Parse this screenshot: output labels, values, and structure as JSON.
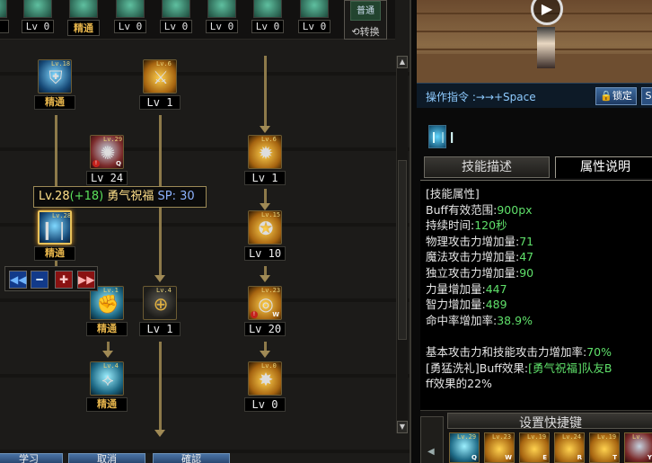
{
  "top_skills": [
    {
      "level": "0",
      "masterized": false
    },
    {
      "level": "Lv 0",
      "masterized": false
    },
    {
      "level": "精通",
      "masterized": true
    },
    {
      "level": "Lv 0",
      "masterized": false
    },
    {
      "level": "Lv 0",
      "masterized": false
    },
    {
      "level": "Lv 0",
      "masterized": false
    },
    {
      "level": "Lv 0",
      "masterized": false
    },
    {
      "level": "Lv 0",
      "masterized": false
    }
  ],
  "swap": {
    "icon_label": "普通",
    "label": "⟲转换"
  },
  "tree_nodes": [
    {
      "tag": "Lv.18",
      "level": "精通",
      "masterized": true,
      "icon": "shield-icon"
    },
    {
      "tag": "Lv.6",
      "level": "Lv 1",
      "masterized": false,
      "icon": "sword-icon"
    },
    {
      "tag": "Lv.29",
      "level": "Lv 24",
      "masterized": false,
      "icon": "swirl-icon"
    },
    {
      "tag": "Lv.6",
      "level": "Lv 1",
      "masterized": false,
      "icon": "flame-icon"
    },
    {
      "tag": "Lv.28",
      "level": "精通",
      "masterized": true,
      "icon": "blessing-icon"
    },
    {
      "tag": "Lv.15",
      "level": "Lv 10",
      "masterized": false,
      "icon": "lion-icon"
    },
    {
      "tag": "Lv.1",
      "level": "精通",
      "masterized": true,
      "icon": "fist-icon"
    },
    {
      "tag": "Lv.4",
      "level": "Lv 1",
      "masterized": false,
      "icon": "target-icon"
    },
    {
      "tag": "Lv.23",
      "level": "Lv 20",
      "masterized": false,
      "icon": "ring-icon"
    },
    {
      "tag": "Lv.4",
      "level": "精通",
      "masterized": true,
      "icon": "wings-icon"
    },
    {
      "tag": "Lv.0",
      "level": "Lv 0",
      "masterized": false,
      "icon": "burst-icon"
    }
  ],
  "tooltip": {
    "level": "Lv.28",
    "bonus": "(+18)",
    "name": "勇气祝福",
    "sp_label": "SP",
    "sp_sep": ":",
    "sp_value": "30"
  },
  "controls": {
    "first": "◀◀",
    "minus": "━",
    "plus": "✚",
    "last": "▶▶"
  },
  "bottom_buttons": [
    "学习",
    "取消",
    "確認"
  ],
  "command": {
    "label": "操作指令",
    "sep": ":",
    "keys": "→→+Space"
  },
  "lock_button": "🔒锁定",
  "small_button": "S",
  "tabs": {
    "description": "技能描述",
    "attributes": "属性说明"
  },
  "attributes": {
    "header": "[技能属性]",
    "rows": [
      {
        "label": "Buff有效范围",
        "sep": ":",
        "value": "900px"
      },
      {
        "label": "持续时间",
        "sep": ":",
        "value": "120秒"
      },
      {
        "label": "物理攻击力增加量",
        "sep": ":",
        "value": "71"
      },
      {
        "label": "魔法攻击力增加量",
        "sep": ":",
        "value": "47"
      },
      {
        "label": "独立攻击力增加量",
        "sep": ":",
        "value": "90"
      },
      {
        "label": "力量增加量",
        "sep": ":",
        "value": "447"
      },
      {
        "label": "智力增加量",
        "sep": ":",
        "value": "489"
      },
      {
        "label": "命中率增加率",
        "sep": ":",
        "value": "38.9%"
      }
    ],
    "extra1_label": "基本攻击力和技能攻击力增加率",
    "extra1_sep": ":",
    "extra1_value": "70%",
    "extra2_pre": "[勇猛洗礼]Buff效果",
    "extra2_sep": ":",
    "extra2_value": "[勇气祝福]队友B",
    "extra3": "ff效果的22%"
  },
  "quickkeys": {
    "title": "设置快捷键",
    "slots": [
      {
        "tag": "Lv.29",
        "key": "Q"
      },
      {
        "tag": "Lv.23",
        "key": "W"
      },
      {
        "tag": "Lv.19",
        "key": "E"
      },
      {
        "tag": "Lv.24",
        "key": "R"
      },
      {
        "tag": "Lv.19",
        "key": "T"
      },
      {
        "tag": "Lv.",
        "key": "Y"
      }
    ]
  },
  "colors": {
    "gold_text": "#e3b24a",
    "green_value": "#5fe06a",
    "tooltip_text": "#ffe08a",
    "accent_blue": "#8ecbff"
  }
}
